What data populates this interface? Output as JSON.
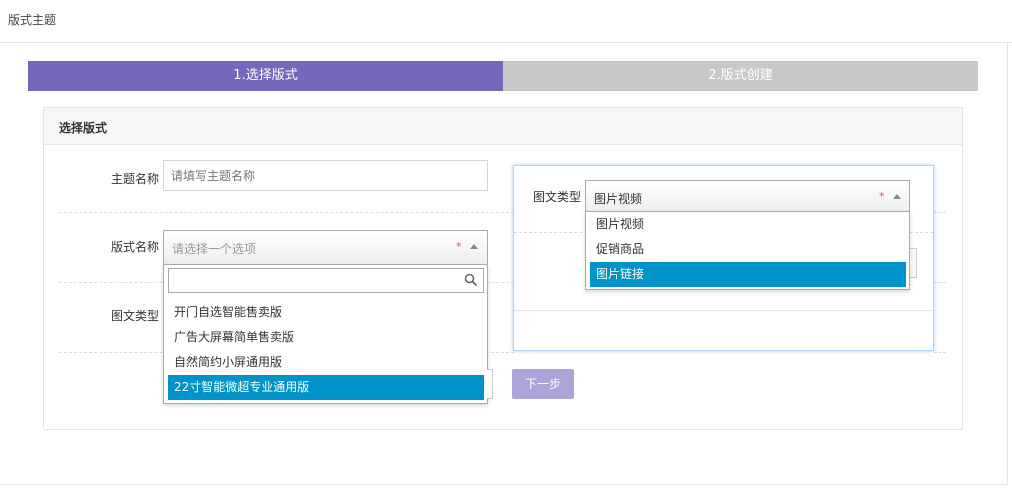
{
  "page": {
    "title": "版式主题"
  },
  "steps": [
    {
      "label": "1.选择版式",
      "active": true
    },
    {
      "label": "2.版式创建",
      "active": false
    }
  ],
  "colors": {
    "active_step": "#7567bb",
    "inactive_step": "#c8c8c8",
    "selected_option": "#0093c9",
    "next_button": "#aca3d8"
  },
  "panel": {
    "title": "选择版式"
  },
  "form": {
    "theme_name": {
      "label": "主题名称",
      "placeholder": "请填写主题名称",
      "value": ""
    },
    "layout_name": {
      "label": "版式名称",
      "placeholder": "请选择一个选项",
      "required_mark": "*",
      "search_value": "",
      "options": [
        "开门自选智能售卖版",
        "广告大屏幕简单售卖版",
        "自然简约小屏通用版",
        "22寸智能微超专业通用版"
      ],
      "highlighted_index": 3
    },
    "media_type": {
      "label": "图文类型"
    },
    "next_button": "下一步"
  },
  "modal": {
    "media_type_label": "图文类型",
    "select_value": "图片视频",
    "required_mark": "*",
    "options": [
      "图片视频",
      "促销商品",
      "图片链接"
    ],
    "highlighted_index": 2
  },
  "icons": {
    "search": "search-icon",
    "arrow": "chevron-up-icon"
  }
}
